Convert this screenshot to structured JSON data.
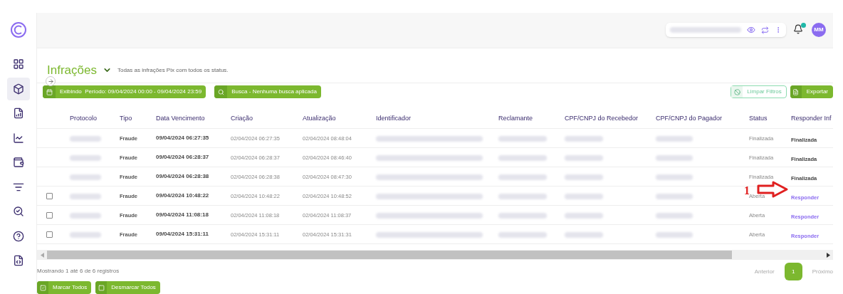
{
  "header": {
    "avatar": "MM",
    "notification_badge": true
  },
  "page": {
    "title": "Infrações",
    "subtitle": "Todas as infrações Pix com todos os status."
  },
  "filters": [
    {
      "kind": "period",
      "label": "Exibindo  Período: 09/04/2024 00:00 - 09/04/2024 23:59"
    },
    {
      "kind": "search",
      "label": "Busca - Nenhuma busca aplicada"
    }
  ],
  "actions": [
    {
      "kind": "outline",
      "label": "Limpar Filtros"
    },
    {
      "kind": "solid",
      "label": "Exportar"
    }
  ],
  "table": {
    "columns": [
      "Protocolo",
      "Tipo",
      "Data Vencimento",
      "Criação",
      "Atualização",
      "Identificador",
      "Reclamante",
      "CPF/CNPJ do Recebedor",
      "CPF/CNPJ do Pagador",
      "Status",
      "Responder Inf"
    ],
    "rows": [
      {
        "selectable": false,
        "tipo": "Fraude",
        "vencimento": "09/04/2024 06:27:35",
        "criacao": "02/04/2024 06:27:35",
        "atualizacao": "02/04/2024 08:48:04",
        "status": "Finalizada",
        "action": {
          "kind": "status",
          "label": "Finalizada"
        },
        "annotation": null
      },
      {
        "selectable": false,
        "tipo": "Fraude",
        "vencimento": "09/04/2024 06:28:37",
        "criacao": "02/04/2024 06:28:37",
        "atualizacao": "02/04/2024 08:46:40",
        "status": "Finalizada",
        "action": {
          "kind": "status",
          "label": "Finalizada"
        },
        "annotation": null
      },
      {
        "selectable": false,
        "tipo": "Fraude",
        "vencimento": "09/04/2024 06:28:38",
        "criacao": "02/04/2024 06:28:38",
        "atualizacao": "02/04/2024 08:47:30",
        "status": "Finalizada",
        "action": {
          "kind": "status",
          "label": "Finalizada"
        },
        "annotation": null
      },
      {
        "selectable": true,
        "checked": false,
        "tipo": "Fraude",
        "vencimento": "09/04/2024 10:48:22",
        "criacao": "02/04/2024 10:48:22",
        "atualizacao": "02/04/2024 10:48:52",
        "status": "Aberta",
        "action": {
          "kind": "link",
          "label": "Responder"
        },
        "annotation": "1"
      },
      {
        "selectable": true,
        "checked": false,
        "tipo": "Fraude",
        "vencimento": "09/04/2024 11:08:18",
        "criacao": "02/04/2024 11:08:18",
        "atualizacao": "02/04/2024 11:08:37",
        "status": "Aberta",
        "action": {
          "kind": "link",
          "label": "Responder"
        },
        "annotation": null
      },
      {
        "selectable": true,
        "checked": false,
        "tipo": "Fraude",
        "vencimento": "09/04/2024 15:31:11",
        "criacao": "02/04/2024 15:31:11",
        "atualizacao": "02/04/2024 15:31:31",
        "status": "Aberta",
        "action": {
          "kind": "link",
          "label": "Responder"
        },
        "annotation": null
      }
    ]
  },
  "footer": {
    "summary": "Mostrando 1 até 6 de 6 registros",
    "buttons": [
      {
        "kind": "check",
        "label": "Marcar Todos"
      },
      {
        "kind": "uncheck",
        "label": "Desmarcar Todos"
      }
    ]
  },
  "pagination": {
    "previous": "Anterior",
    "pages": [
      {
        "label": "1",
        "selected": true
      }
    ],
    "next": "Próximo"
  }
}
